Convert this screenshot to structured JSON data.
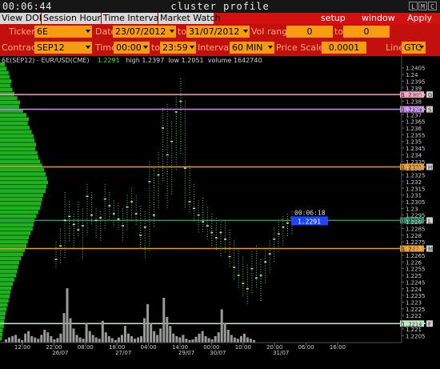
{
  "window": {
    "clock": "00:06:44",
    "title": "cluster profile",
    "buttons": [
      "L",
      "M",
      "C"
    ]
  },
  "menu": {
    "tabs": [
      "View DOM",
      "Session Hours",
      "Time Interval",
      "Market Watch"
    ],
    "right": [
      "setup",
      "window",
      "Apply"
    ]
  },
  "params": {
    "ticker_label": "Ticker",
    "ticker": "6E",
    "date_label": "Date",
    "date_from": "23/07/2012",
    "to_label": "to",
    "date_to": "31/07/2012",
    "vol_label": "Vol range",
    "vol_from": "0",
    "vol_to_label": "to",
    "vol_to": "0",
    "contract_label": "Contract",
    "contract": "SEP12",
    "time_label": "Time",
    "time_from": "00:00",
    "time_to_label": "to",
    "time_to": "23:59",
    "interval_label": "Interval",
    "interval": "60 MIN",
    "scale_label": "Price Scale",
    "scale": "0.0001",
    "line_label": "Line",
    "line": "GTC"
  },
  "chart_info": {
    "symbol": "6E(SEP12) - EUR/USD(CME)",
    "last": "1.2291",
    "high": "high 1.2397",
    "low": "low 1.2051",
    "volume": "volume 1642740"
  },
  "colors": {
    "menubar": "#d31111",
    "param_row": "#c40f0f",
    "field": "#f59c12",
    "label": "#ffb070",
    "bars": "#3fd13f",
    "profile": "#1fb01f"
  },
  "chart_data": {
    "type": "bar",
    "y_ticks": [
      "1.2405",
      "1.24",
      "1.2395",
      "1.239",
      "1.2385",
      "1.238",
      "1.2375",
      "1.237",
      "1.2365",
      "1.236",
      "1.2355",
      "1.235",
      "1.2345",
      "1.234",
      "1.2335",
      "1.233",
      "1.2325",
      "1.232",
      "1.2315",
      "1.231",
      "1.2305",
      "1.23",
      "1.2295",
      "1.229",
      "1.2285",
      "1.228",
      "1.2275",
      "1.227",
      "1.2265",
      "1.226",
      "1.2255",
      "1.225",
      "1.2245",
      "1.224",
      "1.2235",
      "1.223",
      "1.2225",
      "1.222",
      "1.2215",
      "1.221",
      "1.2205"
    ],
    "ylim": [
      1.2201,
      1.2409
    ],
    "x_ticks": [
      {
        "time": "12:00",
        "date": ""
      },
      {
        "time": "22:00",
        "date": "26/07"
      },
      {
        "time": "08:00",
        "date": ""
      },
      {
        "time": "18:00",
        "date": "27/07"
      },
      {
        "time": "04:00",
        "date": ""
      },
      {
        "time": "14:00",
        "date": "29/07"
      },
      {
        "time": "00:00",
        "date": "30/07"
      },
      {
        "time": "10:00",
        "date": ""
      },
      {
        "time": "20:00",
        "date": "31/07"
      },
      {
        "time": "06:00",
        "date": ""
      },
      {
        "time": "16:00",
        "date": ""
      }
    ],
    "price_lines": [
      {
        "price": 1.2385,
        "label": "1.2385",
        "color": "#ff9cc4",
        "tag": "G"
      },
      {
        "price": 1.2374,
        "label": "1.2374",
        "color": "#cf8cf0",
        "tag": "S"
      },
      {
        "price": 1.2331,
        "label": "1.2331",
        "color": "#f09a22",
        "tag": "H"
      },
      {
        "price": 1.2291,
        "label": "1.2291",
        "color": "#2f8f6a",
        "tag": "L"
      },
      {
        "price": 1.227,
        "label": "1.227",
        "color": "#f09a22",
        "tag": "M"
      },
      {
        "price": 1.2214,
        "label": "1.2214",
        "color": "#bfeec3",
        "tag": "F"
      }
    ],
    "cursor": {
      "time": "00:06:18",
      "price": "1.2291"
    },
    "bars_hlc": [
      [
        1.2275,
        1.2255,
        1.2262
      ],
      [
        1.2285,
        1.2258,
        1.2272
      ],
      [
        1.2312,
        1.2262,
        1.2291
      ],
      [
        1.2305,
        1.2275,
        1.2294
      ],
      [
        1.2296,
        1.227,
        1.2288
      ],
      [
        1.2305,
        1.2278,
        1.2284
      ],
      [
        1.23,
        1.2262,
        1.2287
      ],
      [
        1.2318,
        1.228,
        1.2309
      ],
      [
        1.2312,
        1.2288,
        1.2295
      ],
      [
        1.23,
        1.2278,
        1.2291
      ],
      [
        1.2298,
        1.2276,
        1.2293
      ],
      [
        1.2318,
        1.2284,
        1.2307
      ],
      [
        1.2312,
        1.2292,
        1.2302
      ],
      [
        1.2306,
        1.2286,
        1.2296
      ],
      [
        1.2304,
        1.2284,
        1.2292
      ],
      [
        1.23,
        1.2276,
        1.2287
      ],
      [
        1.231,
        1.2284,
        1.2301
      ],
      [
        1.2315,
        1.229,
        1.2305
      ],
      [
        1.231,
        1.2287,
        1.2296
      ],
      [
        1.2302,
        1.227,
        1.228
      ],
      [
        1.2298,
        1.2262,
        1.2286
      ],
      [
        1.2335,
        1.2268,
        1.232
      ],
      [
        1.233,
        1.2286,
        1.2295
      ],
      [
        1.2342,
        1.23,
        1.2325
      ],
      [
        1.2375,
        1.232,
        1.236
      ],
      [
        1.2378,
        1.23,
        1.234
      ],
      [
        1.2365,
        1.231,
        1.235
      ],
      [
        1.2385,
        1.2328,
        1.2372
      ],
      [
        1.2397,
        1.234,
        1.238
      ],
      [
        1.238,
        1.23,
        1.233
      ],
      [
        1.2332,
        1.2296,
        1.2305
      ],
      [
        1.2318,
        1.229,
        1.23
      ],
      [
        1.2306,
        1.2282,
        1.2295
      ],
      [
        1.2308,
        1.2282,
        1.229
      ],
      [
        1.2301,
        1.2276,
        1.2287
      ],
      [
        1.2296,
        1.2272,
        1.2282
      ],
      [
        1.2293,
        1.2268,
        1.2278
      ],
      [
        1.229,
        1.2264,
        1.2282
      ],
      [
        1.2291,
        1.2266,
        1.2277
      ],
      [
        1.2284,
        1.2256,
        1.2264
      ],
      [
        1.2276,
        1.2246,
        1.2256
      ],
      [
        1.227,
        1.224,
        1.225
      ],
      [
        1.2264,
        1.2234,
        1.2244
      ],
      [
        1.2258,
        1.2228,
        1.224
      ],
      [
        1.2268,
        1.2236,
        1.2255
      ],
      [
        1.2272,
        1.224,
        1.2248
      ],
      [
        1.2262,
        1.223,
        1.225
      ],
      [
        1.227,
        1.2244,
        1.226
      ],
      [
        1.2276,
        1.2252,
        1.2266
      ],
      [
        1.2286,
        1.226,
        1.2277
      ],
      [
        1.229,
        1.2268,
        1.2281
      ],
      [
        1.2294,
        1.2272,
        1.2286
      ],
      [
        1.2296,
        1.2278,
        1.2289
      ],
      [
        1.2298,
        1.228,
        1.2293
      ]
    ],
    "volume": [
      0.05,
      0.08,
      0.1,
      0.12,
      0.06,
      0.04,
      0.14,
      0.18,
      0.1,
      0.08,
      0.06,
      0.12,
      0.2,
      0.16,
      0.1,
      0.05,
      0.07,
      0.14,
      0.46,
      0.85,
      0.38,
      0.22,
      0.12,
      0.08,
      0.06,
      0.3,
      0.18,
      0.12,
      0.08,
      0.06,
      0.34,
      0.16,
      0.1,
      0.07,
      0.04,
      0.08,
      0.12,
      0.26,
      0.14,
      0.1,
      0.06,
      0.08,
      0.1,
      0.38,
      0.6,
      0.3,
      0.18,
      0.12,
      0.22,
      0.7,
      0.4,
      0.26,
      0.14,
      0.1,
      0.08,
      0.12,
      0.06,
      0.04,
      0.05,
      0.09,
      0.14,
      0.18,
      0.1,
      0.07,
      0.05,
      0.1,
      0.16,
      0.52,
      0.3,
      0.2,
      0.12,
      0.08,
      0.06,
      0.1,
      0.14,
      0.08,
      0.06,
      0.04
    ],
    "profile": [
      0.1,
      0.14,
      0.18,
      0.2,
      0.24,
      0.22,
      0.26,
      0.3,
      0.36,
      0.42,
      0.4,
      0.48,
      0.55,
      0.6,
      0.58,
      0.62,
      0.66,
      0.7,
      0.72,
      0.75,
      0.74,
      0.78,
      0.8,
      0.84,
      0.88,
      0.92,
      0.95,
      0.98,
      1.0,
      0.97,
      0.95,
      0.9,
      0.88,
      0.86,
      0.84,
      0.8,
      0.76,
      0.72,
      0.7,
      0.68,
      0.64,
      0.6,
      0.58,
      0.55,
      0.52,
      0.48,
      0.44,
      0.4,
      0.38,
      0.36,
      0.34,
      0.3,
      0.27,
      0.24,
      0.22,
      0.2,
      0.18,
      0.16,
      0.14,
      0.12,
      0.1,
      0.09,
      0.08,
      0.06,
      0.05,
      0.04
    ]
  }
}
